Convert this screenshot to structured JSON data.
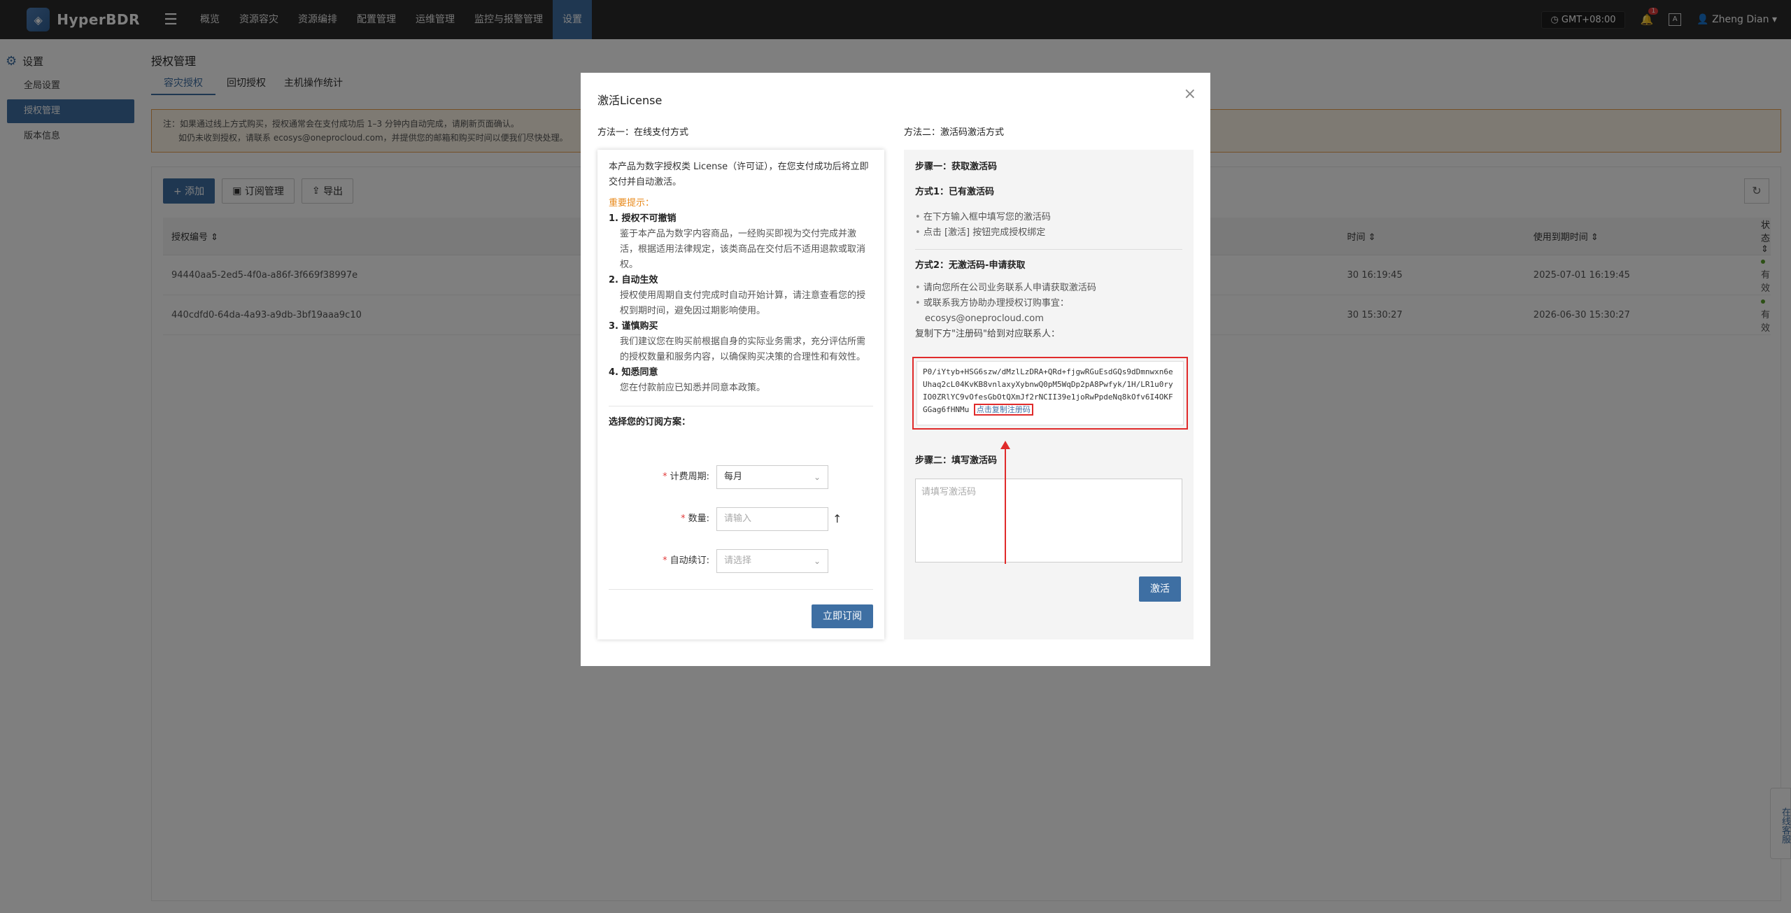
{
  "app": {
    "name": "HyperBDR"
  },
  "topnav": {
    "items": [
      "概览",
      "资源容灾",
      "资源编排",
      "配置管理",
      "运维管理",
      "监控与报警管理",
      "设置"
    ],
    "active_index": 6,
    "timezone": "GMT+08:00",
    "notification_count": "1",
    "user": "Zheng Dian"
  },
  "sidebar": {
    "title": "设置",
    "items": [
      {
        "label": "全局设置"
      },
      {
        "label": "授权管理"
      },
      {
        "label": "版本信息"
      }
    ],
    "active_index": 1
  },
  "page": {
    "title": "授权管理",
    "tabs": [
      "容灾授权",
      "回切授权",
      "主机操作统计"
    ],
    "notice_line1": "注：如果通过线上方式购买，授权通常会在支付成功后 1–3 分钟内自动完成，请刷新页面确认。",
    "notice_line2": "如仍未收到授权，请联系 ecosys@oneprocloud.com，并提供您的邮箱和购买时间以便我们尽快处理。",
    "toolbar": {
      "add": "+ 添加",
      "subscription": "订阅管理",
      "export": "导出"
    },
    "table": {
      "headers": [
        "授权编号 ⇕",
        "",
        "",
        "时间 ⇕",
        "使用到期时间 ⇕",
        "状态 ⇕"
      ],
      "rows": [
        {
          "id": "94440aa5-2ed5-4f0a-a86f-3f669f38997e",
          "time": "30 16:19:45",
          "expire": "2025-07-01 16:19:45",
          "status": "有效"
        },
        {
          "id": "440cdfd0-64da-4a93-a9db-3bf19aaa9c10",
          "time": "30 15:30:27",
          "expire": "2026-06-30 15:30:27",
          "status": "有效"
        }
      ]
    },
    "online_service": "在线客服"
  },
  "modal": {
    "title": "激活License",
    "method1": {
      "label": "方法一：在线支付方式",
      "intro": "本产品为数字授权类 License（许可证），在您支付成功后将立即交付并自动激活。",
      "important": "重要提示：",
      "points": [
        {
          "h": "1. 授权不可撤销",
          "p": "鉴于本产品为数字内容商品，一经购买即视为交付完成并激活，根据适用法律规定，该类商品在交付后不适用退款或取消权。"
        },
        {
          "h": "2. 自动生效",
          "p": "授权使用周期自支付完成时自动开始计算，请注意查看您的授权到期时间，避免因过期影响使用。"
        },
        {
          "h": "3. 谨慎购买",
          "p": "我们建议您在购买前根据自身的实际业务需求，充分评估所需的授权数量和服务内容，以确保购买决策的合理性和有效性。"
        },
        {
          "h": "4. 知悉同意",
          "p": "您在付款前应已知悉并同意本政策。"
        }
      ],
      "plan_title": "选择您的订阅方案：",
      "billing_label": "计费周期:",
      "billing_value": "每月",
      "quantity_label": "数量:",
      "quantity_placeholder": "请输入",
      "renew_label": "自动续订:",
      "renew_placeholder": "请选择",
      "subscribe": "立即订阅"
    },
    "method2": {
      "label": "方法二：激活码激活方式",
      "step1": "步骤一：获取激活码",
      "way1": "方式1：已有激活码",
      "way1_items": [
        "在下方输入框中填写您的激活码",
        "点击 [激活] 按钮完成授权绑定"
      ],
      "way2": "方式2：无激活码-申请获取",
      "way2_items": [
        "请向您所在公司业务联系人申请获取激活码",
        "或联系我方协助办理授权订购事宜："
      ],
      "email": "ecosys@oneprocloud.com",
      "copy_hint": "复制下方\"注册码\"给到对应联系人：",
      "reg_code": "P0/iYtyb+HSG6szw/dMzlLzDRA+QRd+fjgwRGuEsdGQs9dDmnwxn6eUhaq2cL04KvKB8vnlaxyXybnwQ0pM5WqDp2pA8Pwfyk/1H/LR1u0ryIO0ZRlYC9vOfesGbOtQXmJf2rNCII39e1joRwPpdeNq8kOfv6I4OKFGGag6fHNMu",
      "copy_link": "点击复制注册码",
      "step2": "步骤二：填写激活码",
      "activation_placeholder": "请填写激活码",
      "activate": "激活"
    },
    "close": "×"
  },
  "colors": {
    "primary": "#3e6fa3",
    "highlight": "#e02b2b",
    "warning": "#e8891a",
    "status_ok": "#5aa02c"
  }
}
